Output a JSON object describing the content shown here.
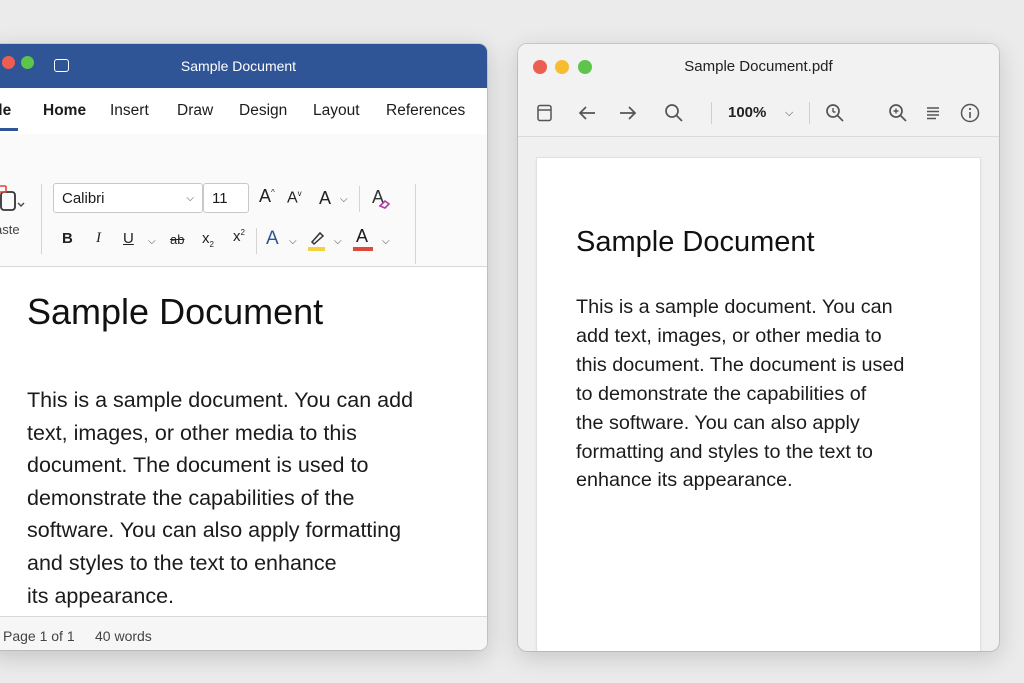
{
  "word": {
    "window_title": "Sample Document",
    "tabs": [
      {
        "label": "ile",
        "active": false
      },
      {
        "label": "Home",
        "active": true
      },
      {
        "label": "Insert",
        "active": false
      },
      {
        "label": "Draw",
        "active": false
      },
      {
        "label": "Design",
        "active": false
      },
      {
        "label": "Layout",
        "active": false
      },
      {
        "label": "References",
        "active": false
      }
    ],
    "ribbon": {
      "paste_label": "aste",
      "font_name": "Calibri",
      "font_size": "11",
      "grow_font": "A",
      "shrink_font": "A",
      "change_case": "A",
      "bold": "B",
      "italic": "I",
      "underline": "U",
      "strikethrough": "ab",
      "subscript": "x",
      "superscript": "x",
      "text_effects": "A",
      "font_color": "A",
      "highlight_color": "#f3d23b",
      "font_color_bar": "#e0483a"
    },
    "document": {
      "heading": "Sample Document",
      "lines": [
        "This is a sample document. You can add",
        "text, images, or other media to this",
        "document. The document is used to",
        "demonstrate the capabilities of the",
        "software. You can also apply formatting",
        "and styles to the text to enhance",
        "its appearance."
      ]
    },
    "status": {
      "page": "Page 1 of 1",
      "words": "40 words"
    },
    "accent": "#2f5597"
  },
  "pdf": {
    "window_title": "Sample Document.pdf",
    "zoom": "100%",
    "document": {
      "heading": "Sample Document",
      "lines": [
        "This is a sample document. You can",
        "add text, images, or other media to",
        "this document. The document is used",
        "to demonstrate the capabilities of",
        "the software. You can also apply",
        "formatting and styles to the text to",
        "enhance its appearance."
      ]
    }
  },
  "traffic_lights": {
    "close": "#ee5d52",
    "minimize": "#f5bd2f",
    "zoom": "#5cc54a"
  }
}
